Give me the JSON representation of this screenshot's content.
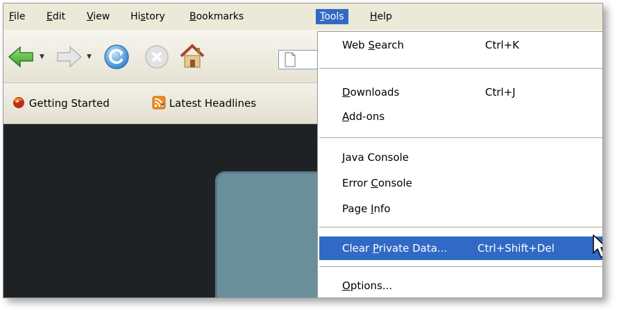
{
  "menubar": {
    "items": [
      {
        "pre": "",
        "ul": "F",
        "post": "ile"
      },
      {
        "pre": "",
        "ul": "E",
        "post": "dit"
      },
      {
        "pre": "",
        "ul": "V",
        "post": "iew"
      },
      {
        "pre": "Hi",
        "ul": "s",
        "post": "tory"
      },
      {
        "pre": "",
        "ul": "B",
        "post": "ookmarks"
      },
      {
        "pre": "",
        "ul": "T",
        "post": "ools"
      },
      {
        "pre": "",
        "ul": "H",
        "post": "elp"
      }
    ]
  },
  "bookmarks": {
    "items": [
      {
        "label": "Getting Started",
        "icon": "firefox-icon"
      },
      {
        "label": "Latest Headlines",
        "icon": "rss-feed-icon"
      }
    ]
  },
  "tools_menu": {
    "items": [
      {
        "pre": "Web ",
        "ul": "S",
        "post": "earch",
        "shortcut": "Ctrl+K"
      },
      {
        "pre": "",
        "ul": "D",
        "post": "ownloads",
        "shortcut": "Ctrl+J"
      },
      {
        "pre": "",
        "ul": "A",
        "post": "dd-ons",
        "shortcut": ""
      },
      {
        "pre": "",
        "ul": "J",
        "post": "ava Console",
        "shortcut": ""
      },
      {
        "pre": "Error ",
        "ul": "C",
        "post": "onsole",
        "shortcut": ""
      },
      {
        "pre": "Page ",
        "ul": "I",
        "post": "nfo",
        "shortcut": ""
      },
      {
        "pre": "Clear ",
        "ul": "P",
        "post": "rivate Data...",
        "shortcut": "Ctrl+Shift+Del"
      },
      {
        "pre": "",
        "ul": "O",
        "post": "ptions...",
        "shortcut": ""
      }
    ]
  },
  "colors": {
    "highlight": "#316ac5",
    "menu_bg": "#ece9d8",
    "content_bg": "#1f2225",
    "card": "#6b8e9b"
  }
}
